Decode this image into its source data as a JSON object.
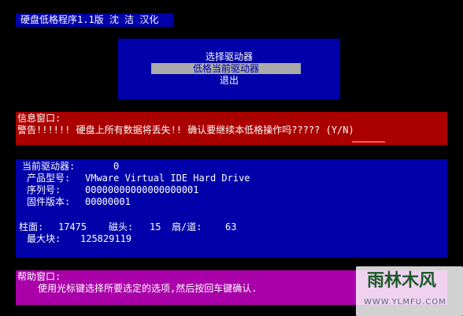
{
  "title": "硬盘低格程序1.1版 沈 洁 汉化",
  "menu": {
    "items": [
      {
        "label": "选择驱动器",
        "selected": false
      },
      {
        "label": "低格当前驱动器",
        "selected": true
      },
      {
        "label": "退出",
        "selected": false
      }
    ]
  },
  "info_window": {
    "title": "信息窗口:",
    "warning": "警告!!!!!!  硬盘上所有数据将丢失!! 确认要继续本低格操作吗????? (Y/N)"
  },
  "drive_window": {
    "current_drive_label": "当前驱动器:",
    "current_drive_value": "0",
    "model_label": "产品型号:",
    "model_value": "VMware Virtual IDE Hard Drive",
    "serial_label": "序列号:",
    "serial_value": "00000000000000000001",
    "firmware_label": "固件版本:",
    "firmware_value": "00000001",
    "cylinders_label": "柱面:",
    "cylinders_value": "17475",
    "heads_label": "磁头:",
    "heads_value": "15",
    "sectors_label": "扇/道:",
    "sectors_value": "63",
    "maxblock_label": "最大块:",
    "maxblock_value": "125829119"
  },
  "help_window": {
    "title": "帮助窗口:",
    "text": "使用光标键选择所要选定的选项,然后按回车键确认."
  },
  "watermark": {
    "main": "雨林木风",
    "url": "WWW.YLMFU.COM"
  },
  "colors": {
    "background": "#000000",
    "blue": "#0000aa",
    "red": "#aa0000",
    "magenta": "#aa00aa",
    "highlight": "#aaaaaa",
    "text": "#ffffff"
  }
}
